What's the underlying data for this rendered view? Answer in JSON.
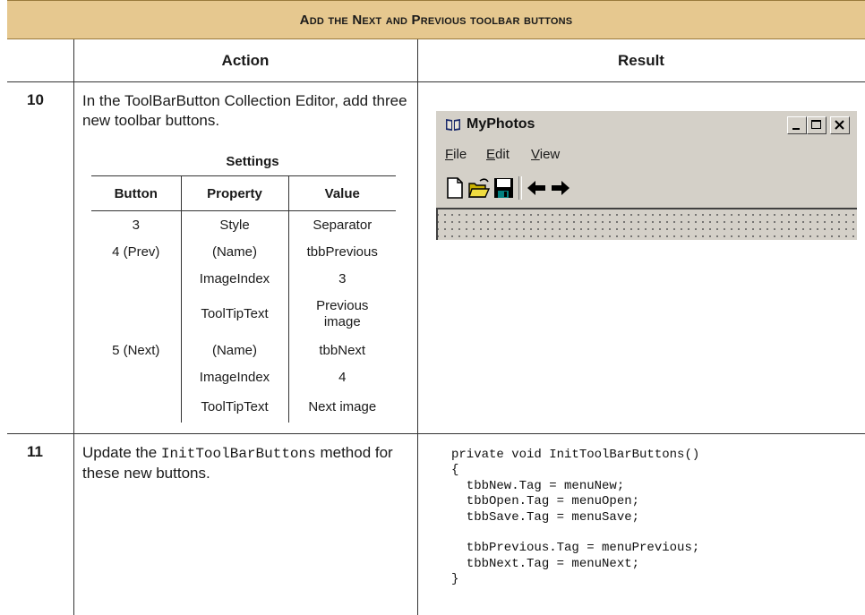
{
  "banner": {
    "title": "Add the Next and Previous toolbar buttons"
  },
  "columns": {
    "action": "Action",
    "result": "Result"
  },
  "steps": [
    {
      "number": "10",
      "text": "In the ToolBarButton Collection Editor, add three new toolbar buttons."
    },
    {
      "number": "11",
      "text_before": "Update the ",
      "method": "InitToolBarButtons",
      "text_after": " method for these new buttons."
    }
  ],
  "settings": {
    "title": "Settings",
    "headers": [
      "Button",
      "Property",
      "Value"
    ],
    "rows": [
      [
        "3",
        "Style",
        "Separator"
      ],
      [
        "4 (Prev)",
        "(Name)",
        "tbbPrevious"
      ],
      [
        "",
        "ImageIndex",
        "3"
      ],
      [
        "",
        "ToolTipText",
        "Previous image"
      ],
      [
        "5 (Next)",
        "(Name)",
        "tbbNext"
      ],
      [
        "",
        "ImageIndex",
        "4"
      ],
      [
        "",
        "ToolTipText",
        "Next image"
      ]
    ]
  },
  "window": {
    "title": "MyPhotos",
    "menu": [
      {
        "u": "F",
        "rest": "ile"
      },
      {
        "u": "E",
        "rest": "dit"
      },
      {
        "u": "V",
        "rest": "iew"
      }
    ],
    "toolbar_icons": [
      "new-file-icon",
      "open-folder-icon",
      "save-disk-icon",
      "arrow-left-icon",
      "arrow-right-icon"
    ],
    "caption_buttons": [
      "minimize-icon",
      "maximize-icon",
      "close-icon"
    ]
  },
  "code": "private void InitToolBarButtons()\n{\n  tbbNew.Tag = menuNew;\n  tbbOpen.Tag = menuOpen;\n  tbbSave.Tag = menuSave;\n\n  tbbPrevious.Tag = menuPrevious;\n  tbbNext.Tag = menuNext;\n}"
}
